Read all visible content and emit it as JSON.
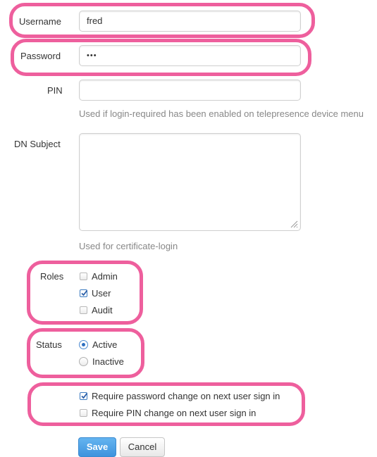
{
  "form": {
    "username": {
      "label": "Username",
      "value": "fred"
    },
    "password": {
      "label": "Password",
      "value": "•••"
    },
    "pin": {
      "label": "PIN",
      "value": "",
      "help": "Used if login-required has been enabled on telepresence device menu"
    },
    "dn_subject": {
      "label": "DN Subject",
      "value": "",
      "help": "Used for certificate-login"
    },
    "roles": {
      "label": "Roles",
      "options": [
        {
          "label": "Admin",
          "checked": false
        },
        {
          "label": "User",
          "checked": true
        },
        {
          "label": "Audit",
          "checked": false
        }
      ]
    },
    "status": {
      "label": "Status",
      "options": [
        {
          "label": "Active",
          "selected": true
        },
        {
          "label": "Inactive",
          "selected": false
        }
      ]
    },
    "require_password_change": {
      "label": "Require password change on next user sign in",
      "checked": true
    },
    "require_pin_change": {
      "label": "Require PIN change on next user sign in",
      "checked": false
    },
    "buttons": {
      "save": "Save",
      "cancel": "Cancel"
    }
  },
  "colors": {
    "highlight": "#ee5f9d",
    "primary": "#3e93dd",
    "help_text": "#888888"
  }
}
